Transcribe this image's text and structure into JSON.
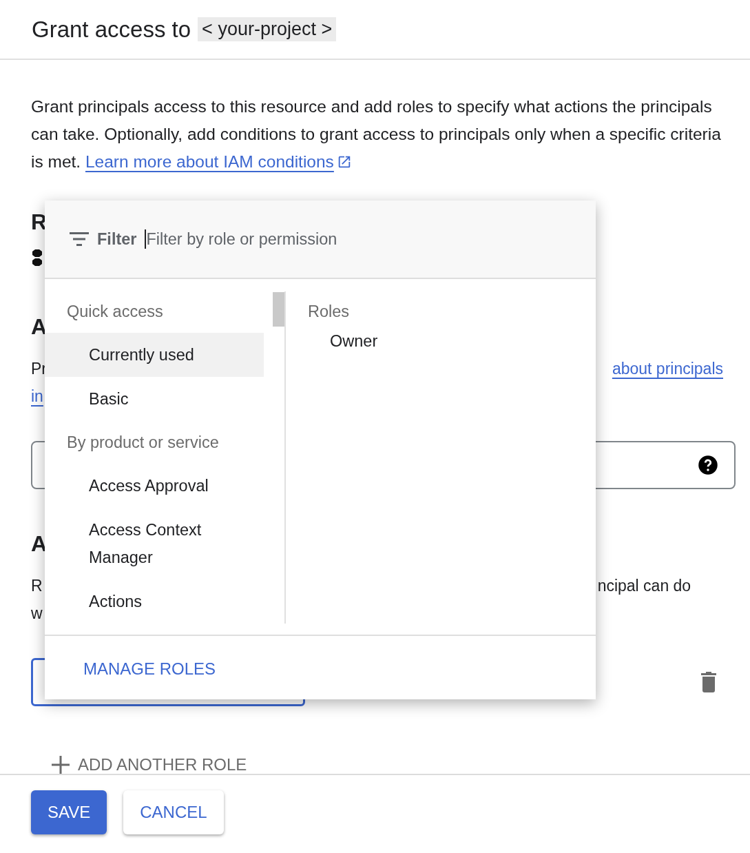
{
  "header": {
    "title": "Grant access to",
    "project": "< your-project >"
  },
  "intro": {
    "text": "Grant principals access to this resource and add roles to specify what actions the principals can take. Optionally, add conditions to grant access to principals only when a specific criteria is met.",
    "link": "Learn more about IAM conditions"
  },
  "resource_section": {
    "heading": "R"
  },
  "principals_section": {
    "heading": "A",
    "text": "Pr",
    "link_start": "in",
    "link_end": "about principals"
  },
  "roles_section": {
    "heading": "A",
    "text": "R",
    "text_line_2": "w",
    "text_end": "ncipal can do"
  },
  "add_another_role": "ADD ANOTHER ROLE",
  "buttons": [
    {
      "label": "SAVE",
      "kind": "primary"
    },
    {
      "label": "CANCEL",
      "kind": "secondary"
    }
  ],
  "role_picker": {
    "filter_label": "Filter",
    "placeholder": "Filter by role or permission",
    "groups": [
      {
        "title": "Quick access",
        "items": [
          {
            "label": "Currently used",
            "selected": true
          },
          {
            "label": "Basic",
            "selected": false
          }
        ]
      },
      {
        "title": "By product or service",
        "items": [
          {
            "label": "Access Approval",
            "selected": false
          },
          {
            "label": "Access Context Manager",
            "selected": false
          },
          {
            "label": "Actions",
            "selected": false
          }
        ]
      }
    ],
    "roles_heading": "Roles",
    "roles": [
      "Owner"
    ],
    "manage": "MANAGE ROLES"
  }
}
